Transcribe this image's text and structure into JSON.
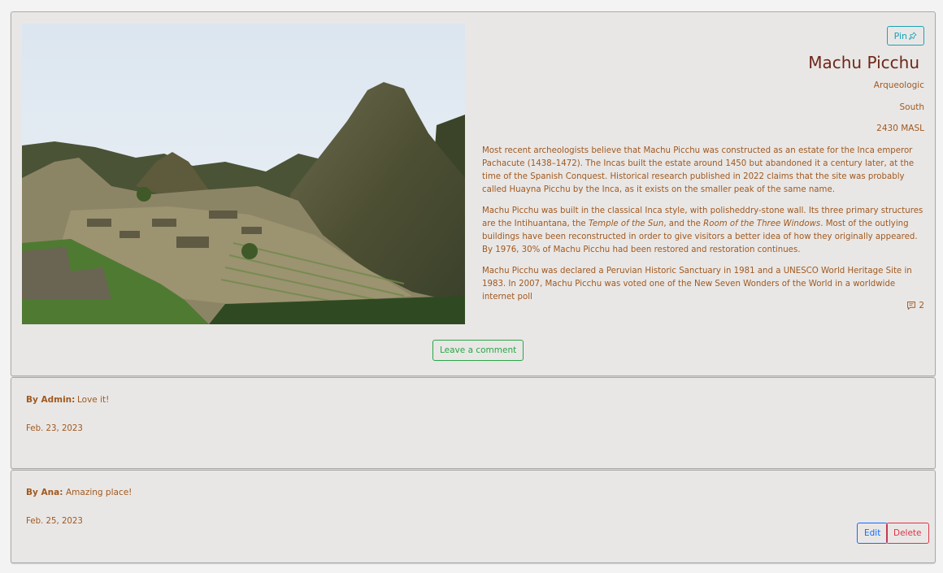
{
  "post": {
    "pin_label": "Pin",
    "title": "Machu Picchu",
    "category": "Arqueologic",
    "region": "South",
    "altitude": "2430 MASL",
    "description": {
      "p1": "Most recent archeologists believe that Machu Picchu was constructed as an estate for the Inca emperor Pachacute (1438–1472). The Incas built the estate around 1450 but abandoned it a century later, at the time of the Spanish Conquest.  Historical research published in 2022 claims that the site was probably called Huayna Picchu by the Inca, as it exists on the smaller peak of the same name.",
      "p2_a": "Machu Picchu was built in the classical Inca style, with polisheddry-stone wall. Its three primary structures are the Intihuantana, the ",
      "p2_em1": "Temple of the Sun",
      "p2_b": ", and the ",
      "p2_em2": "Room of the Three Windows",
      "p2_c": ". Most of the outlying buildings have been reconstructed in order to give visitors a better idea of how they originally appeared. By 1976, 30% of Machu Picchu had been restored and restoration continues.",
      "p3": "Machu Picchu was declared a Peruvian Historic Sanctuary in 1981 and a UNESCO World Heritage Site in 1983. In 2007, Machu Picchu was voted one of the New Seven Wonders of the World in a worldwide internet poll"
    },
    "comment_count": "2",
    "leave_comment_label": "Leave a comment"
  },
  "comments": [
    {
      "author": "By Admin:",
      "text": "Love it!",
      "date": "Feb. 23, 2023"
    },
    {
      "author": "By Ana:",
      "text": "Amazing place!",
      "date": "Feb. 25, 2023",
      "edit_label": "Edit",
      "delete_label": "Delete"
    }
  ],
  "colors": {
    "text": "#a0591f",
    "title": "#6e2718",
    "pin": "#17a2b8",
    "leave_comment": "#28a745",
    "edit": "#0d6efd",
    "delete": "#dc3545"
  },
  "icons": {
    "pin": "pin-icon",
    "comment": "chat-square-icon"
  }
}
